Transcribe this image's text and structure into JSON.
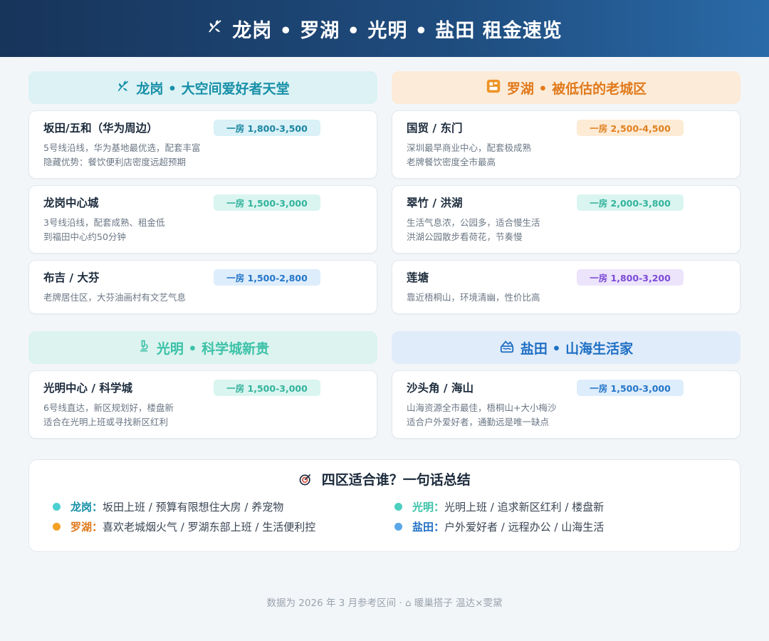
{
  "header": {
    "title": "龙岗 • 罗湖 • 光明 • 盐田 租金速览"
  },
  "districts": {
    "longgang": {
      "title": "龙岗 • 大空间爱好者天堂",
      "cards": [
        {
          "name": "坂田/五和（华为周边）",
          "price": "一房 1,800-3,500",
          "line1": "5号线沿线，华为基地最优选，配套丰富",
          "line2": "隐藏优势：餐饮便利店密度远超预期"
        },
        {
          "name": "龙岗中心城",
          "price": "一房 1,500-3,000",
          "line1": "3号线沿线，配套成熟、租金低",
          "line2": "到福田中心约50分钟"
        },
        {
          "name": "布吉 / 大芬",
          "price": "一房 1,500-2,800",
          "line1": "老牌居住区，大芬油画村有文艺气息"
        }
      ]
    },
    "luohu": {
      "title": "罗湖 • 被低估的老城区",
      "cards": [
        {
          "name": "国贸 / 东门",
          "price": "一房 2,500-4,500",
          "line1": "深圳最早商业中心，配套极成熟",
          "line2": "老牌餐饮密度全市最高"
        },
        {
          "name": "翠竹 / 洪湖",
          "price": "一房 2,000-3,800",
          "line1": "生活气息浓，公园多，适合慢生活",
          "line2": "洪湖公园散步看荷花，节奏慢"
        },
        {
          "name": "莲塘",
          "price": "一房 1,800-3,200",
          "line1": "靠近梧桐山，环境清幽，性价比高"
        }
      ]
    },
    "guangming": {
      "title": "光明 • 科学城新贵",
      "cards": [
        {
          "name": "光明中心 / 科学城",
          "price": "一房 1,500-3,000",
          "line1": "6号线直达，新区规划好，楼盘新",
          "line2": "适合在光明上班或寻找新区红利"
        }
      ]
    },
    "yantian": {
      "title": "盐田 • 山海生活家",
      "cards": [
        {
          "name": "沙头角 / 海山",
          "price": "一房 1,500-3,000",
          "line1": "山海资源全市最佳，梧桐山+大小梅沙",
          "line2": "适合户外爱好者，通勤远是唯一缺点"
        }
      ]
    }
  },
  "summary": {
    "title": "四区适合谁？一句话总结",
    "items": [
      {
        "label": "龙岗：",
        "text": "坂田上班 / 预算有限想住大房 / 养宠物",
        "color": "#4ccfd0"
      },
      {
        "label": "罗湖：",
        "text": "喜欢老城烟火气 / 罗湖东部上班 / 生活便利控",
        "color": "#f3a024"
      },
      {
        "label": "光明：",
        "text": "光明上班 / 追求新区红利 / 楼盘新",
        "color": "#4ccfbf"
      },
      {
        "label": "盐田：",
        "text": "户外爱好者 / 远程办公 / 山海生活",
        "color": "#5aa7e8"
      }
    ]
  },
  "footer": {
    "text": "数据为 2026 年 3 月参考区间 · ⌂ 暖巢搭子 温达×雯黛"
  },
  "colors": {
    "longgang": "#1790a8",
    "luohu": "#e07a1c",
    "guangming": "#3cc2a8",
    "yantian": "#1f6fc4",
    "ochre": "#ee9326",
    "purple": "#7c4ad6"
  }
}
